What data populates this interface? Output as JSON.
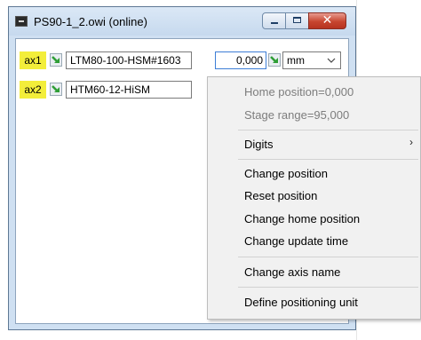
{
  "window": {
    "title": "PS90-1_2.owi (online)",
    "close_glyph": "✕"
  },
  "axes": [
    {
      "tag": "ax1",
      "stage": "LTM80-100-HSM#1603",
      "position": "0,000",
      "unit": "mm"
    },
    {
      "tag": "ax2",
      "stage": "HTM60-12-HiSM"
    }
  ],
  "menu": {
    "home_position": "Home position=0,000",
    "stage_range": "Stage range=95,000",
    "digits": "Digits",
    "change_position": "Change position",
    "reset_position": "Reset position",
    "change_home_position": "Change home position",
    "change_update_time": "Change update time",
    "change_axis_name": "Change axis name",
    "define_positioning_unit": "Define positioning unit",
    "submenu_arrow": "›"
  },
  "colors": {
    "axis_tag_bg": "#f3ee3a",
    "arrow_green": "#2f9e36",
    "close_red": "#c7452f",
    "focus_blue": "#3d7ed6"
  },
  "icons": {
    "app": "app-window-icon",
    "arrow": "green-arrow-icon"
  }
}
